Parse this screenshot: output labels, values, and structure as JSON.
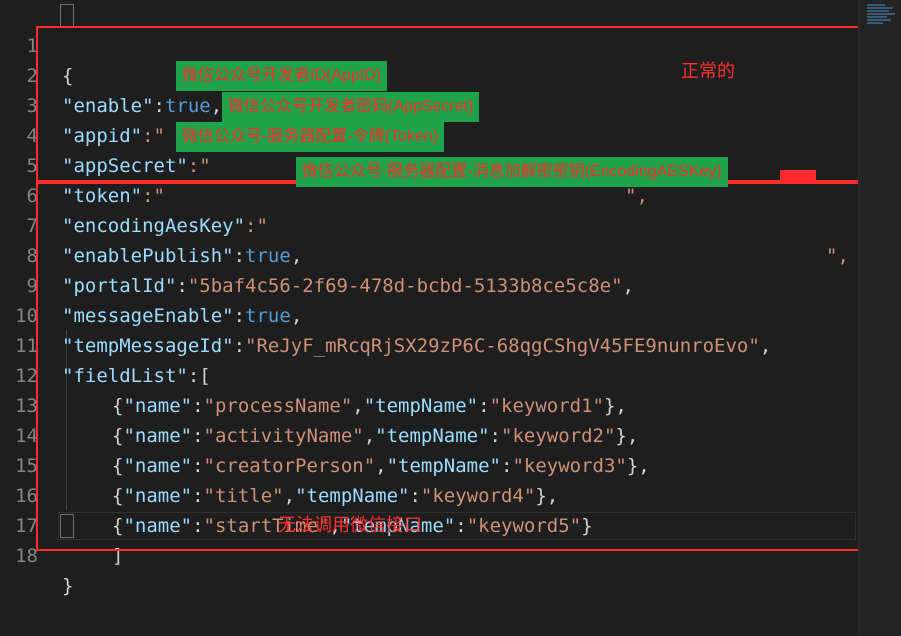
{
  "editor": {
    "lines": [
      {
        "num": "1"
      },
      {
        "num": "2",
        "key": "\"enable\"",
        "sep": ":",
        "val": "true",
        "tail": ","
      },
      {
        "num": "3",
        "key": "\"appid\"",
        "sep": ":\"",
        "tail": ","
      },
      {
        "num": "4",
        "key": "\"appSecret\"",
        "sep": ":\"",
        "tail": "\","
      },
      {
        "num": "5",
        "key": "\"token\"",
        "sep": ":\""
      },
      {
        "num": "6",
        "key": "\"encodingAesKey\"",
        "sep": ":\"",
        "tail": "\","
      },
      {
        "num": "7",
        "key": "\"enablePublish\"",
        "sep": ":",
        "val": "true",
        "tail": ","
      },
      {
        "num": "8",
        "key": "\"portalId\"",
        "sep": ":",
        "val": "\"5baf4c56-2f69-478d-bcbd-5133b8ce5c8e\"",
        "tail": ","
      },
      {
        "num": "9",
        "key": "\"messageEnable\"",
        "sep": ":",
        "val": "true",
        "tail": ","
      },
      {
        "num": "10",
        "key": "\"tempMessageId\"",
        "sep": ":",
        "val": "\"ReJyF_mRcqRjSX29zP6C-68qgCShgV45FE9nunroEvo\"",
        "tail": ","
      },
      {
        "num": "11",
        "key": "\"fieldList\"",
        "sep": ":["
      },
      {
        "num": "12",
        "name": "\"processName\"",
        "temp": "\"keyword1\"",
        "tail": "},"
      },
      {
        "num": "13",
        "name": "\"activityName\"",
        "temp": "\"keyword2\"",
        "tail": "},"
      },
      {
        "num": "14",
        "name": "\"creatorPerson\"",
        "temp": "\"keyword3\"",
        "tail": "},"
      },
      {
        "num": "15",
        "name": "\"title\"",
        "temp": "\"keyword4\"",
        "tail": "},"
      },
      {
        "num": "16",
        "name": "\"startTime\"",
        "temp": "\"keyword5\"",
        "tail": "}"
      },
      {
        "num": "17",
        "text": "]"
      },
      {
        "num": "18",
        "text": "}"
      }
    ],
    "open_brace": "{",
    "name_key": "\"name\"",
    "temp_key": "\"tempName\"",
    "obj_open": "{",
    "colon": ":",
    "comma": ","
  },
  "annotations": {
    "appid_label": "微信公众号开发者ID(AppID)",
    "appsecret_label": "微信公众号开发者密码(AppSecret)",
    "token_label": "微信公众号-服务器配置-令牌(Token)",
    "aeskey_label": "微信公众号-服务器配置-消息加解密密钥(EncodingAESKey)",
    "normal_note": "正常的",
    "broken_note": "无法调用微信接口"
  },
  "colors": {
    "box": "#ff2a2a",
    "label_bg": "#1fa34a",
    "key": "#9cdcfe",
    "string": "#ce9178",
    "keyword": "#569cd6"
  }
}
